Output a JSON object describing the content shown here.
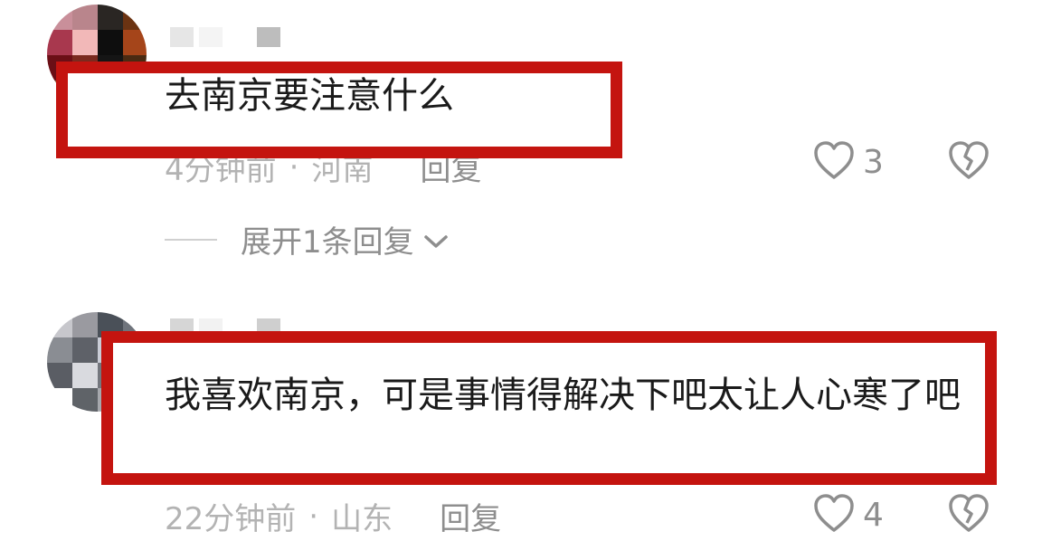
{
  "comments": [
    {
      "text": "去南京要注意什么",
      "time": "4分钟前",
      "sep": "·",
      "location": "河南",
      "reply_label": "回复",
      "likes": "3"
    },
    {
      "text": "我喜欢南京，可是事情得解决下吧太让人心寒了吧",
      "time": "22分钟前",
      "sep": "·",
      "location": "山东",
      "reply_label": "回复",
      "likes": "4"
    }
  ],
  "expand_replies_label": "展开1条回复",
  "colors": {
    "highlight_box": "#c4140f",
    "meta_text": "#b3b3b3",
    "icon": "#8e8e8e"
  },
  "icons": [
    "heart-outline-icon",
    "broken-heart-icon",
    "chevron-down-icon"
  ]
}
